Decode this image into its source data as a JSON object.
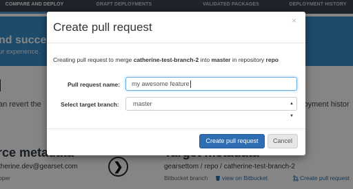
{
  "nav": {
    "tabs": [
      "COMPARE AND DEPLOY",
      "DRAFT DEPLOYMENTS",
      "VALIDATED PACKAGES",
      "DEPLOYMENT HISTORY"
    ],
    "active_index": 0
  },
  "banner": {
    "title": "nd successf",
    "subtitle": "ur experience."
  },
  "background": {
    "heading_fragment": "l",
    "revert_text": "an revert the",
    "history_text": "ployment histor",
    "source": {
      "title": "rce metadata",
      "email": "therine.dev@gearset.com",
      "type": "oper"
    },
    "arrow": "❯",
    "target": {
      "title": "Target metadata",
      "path": "gearsettom / repo / catherine-test-branch-2",
      "type": "Bitbucket branch",
      "view_link": "view on Bitbucket",
      "create_link": "Create pull request"
    }
  },
  "modal": {
    "title": "Create pull request",
    "close": "×",
    "description": {
      "prefix": "Creating pull request to merge ",
      "source_branch": "catherine-test-branch-2",
      "middle": " into ",
      "target_branch": "master",
      "suffix": " in repository ",
      "repository": "repo"
    },
    "pr_name_label": "Pull request name:",
    "pr_name_value": "my awesome feature",
    "branch_label": "Select target branch:",
    "branch_value": "master",
    "create_button": "Create pull request",
    "cancel_button": "Cancel"
  },
  "colors": {
    "nav_bg": "#3c4451",
    "banner_bg": "#3a8fd0",
    "primary_button": "#2f6db3",
    "input_focus": "#66afe9"
  }
}
